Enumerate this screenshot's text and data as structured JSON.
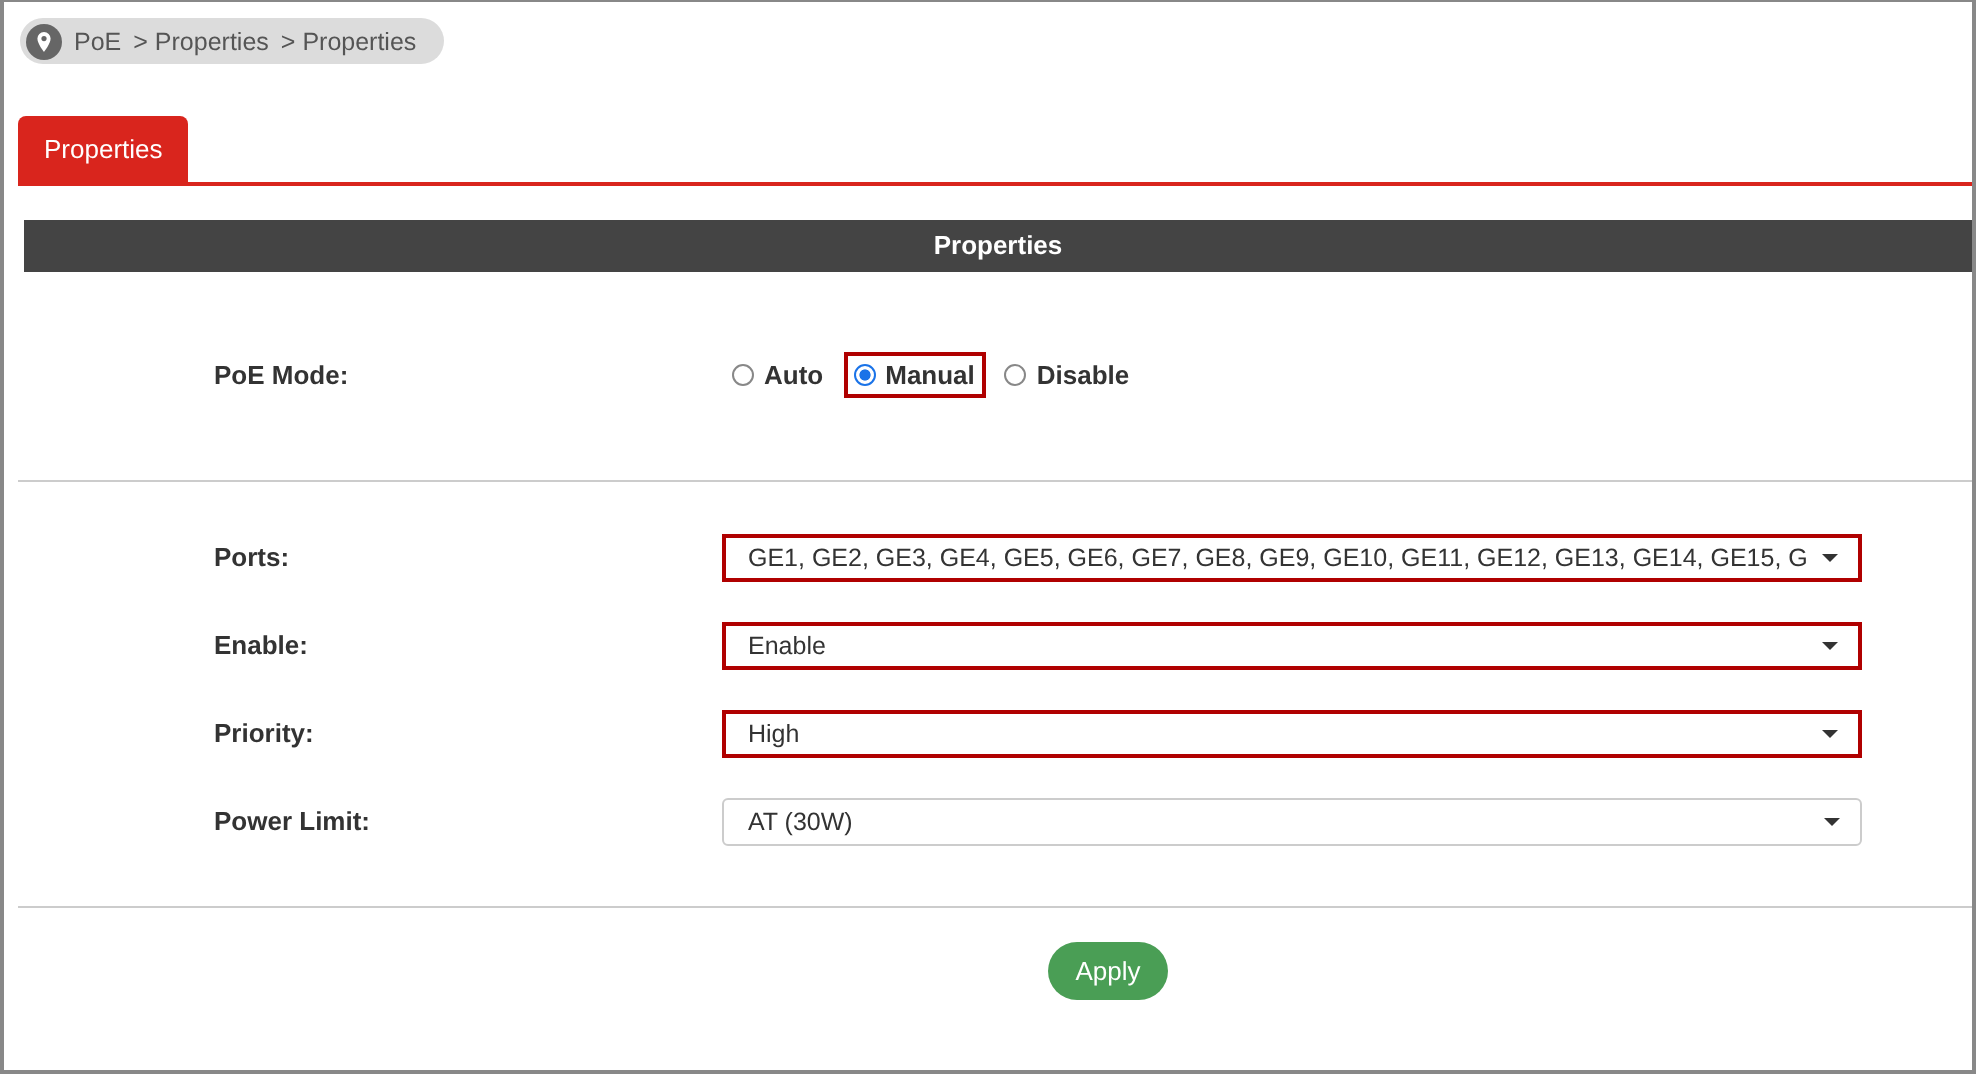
{
  "breadcrumb": {
    "items": [
      "PoE",
      "Properties",
      "Properties"
    ],
    "separator": ">"
  },
  "tabs": [
    {
      "label": "Properties",
      "selected": true
    }
  ],
  "section": {
    "title": "Properties"
  },
  "poe_mode": {
    "label": "PoE Mode:",
    "options": [
      {
        "label": "Auto",
        "selected": false,
        "highlighted": false
      },
      {
        "label": "Manual",
        "selected": true,
        "highlighted": true
      },
      {
        "label": "Disable",
        "selected": false,
        "highlighted": false
      }
    ]
  },
  "fields": [
    {
      "label": "Ports:",
      "value": "GE1, GE2, GE3, GE4, GE5, GE6, GE7, GE8, GE9, GE10, GE11, GE12, GE13, GE14, GE15, G",
      "highlighted": true
    },
    {
      "label": "Enable:",
      "value": "Enable",
      "highlighted": true
    },
    {
      "label": "Priority:",
      "value": "High",
      "highlighted": true
    },
    {
      "label": "Power Limit:",
      "value": "AT (30W)",
      "highlighted": false
    }
  ],
  "buttons": [
    {
      "label": "Apply"
    }
  ]
}
